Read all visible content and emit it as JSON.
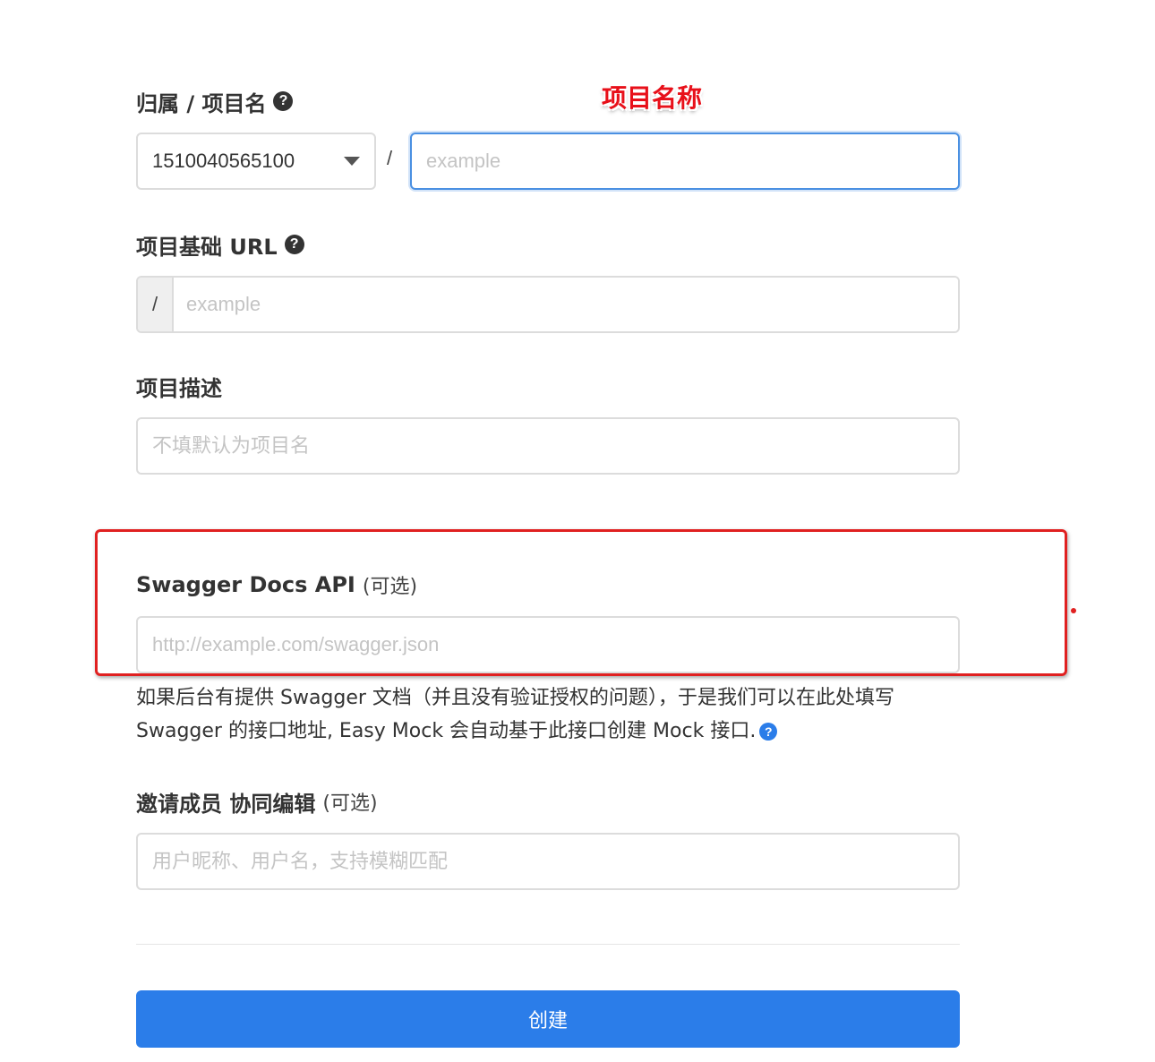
{
  "annotation": {
    "project_name_note": "项目名称"
  },
  "fields": {
    "owner_project": {
      "label": "归属 / 项目名",
      "owner_value": "1510040565100",
      "separator": "/",
      "name_placeholder": "example",
      "help_icon": "question-circle-icon"
    },
    "base_url": {
      "label": "项目基础 URL",
      "prefix": "/",
      "placeholder": "example",
      "help_icon": "question-circle-icon"
    },
    "description": {
      "label": "项目描述",
      "placeholder": "不填默认为项目名"
    },
    "swagger": {
      "label": "Swagger Docs API",
      "optional": "(可选)",
      "placeholder": "http://example.com/swagger.json",
      "help_line1": "如果后台有提供 Swagger 文档（并且没有验证授权的问题），于是我们可以在此处填写",
      "help_line2": "Swagger 的接口地址, Easy Mock 会自动基于此接口创建 Mock 接口.",
      "help_icon": "question-circle-icon"
    },
    "members": {
      "label": "邀请成员 协同编辑",
      "optional": "(可选)",
      "placeholder": "用户昵称、用户名，支持模糊匹配"
    }
  },
  "submit": {
    "label": "创建"
  },
  "colors": {
    "primary": "#2b7de9",
    "annotation_red": "#e02020",
    "focus_border": "#4a90e2"
  }
}
